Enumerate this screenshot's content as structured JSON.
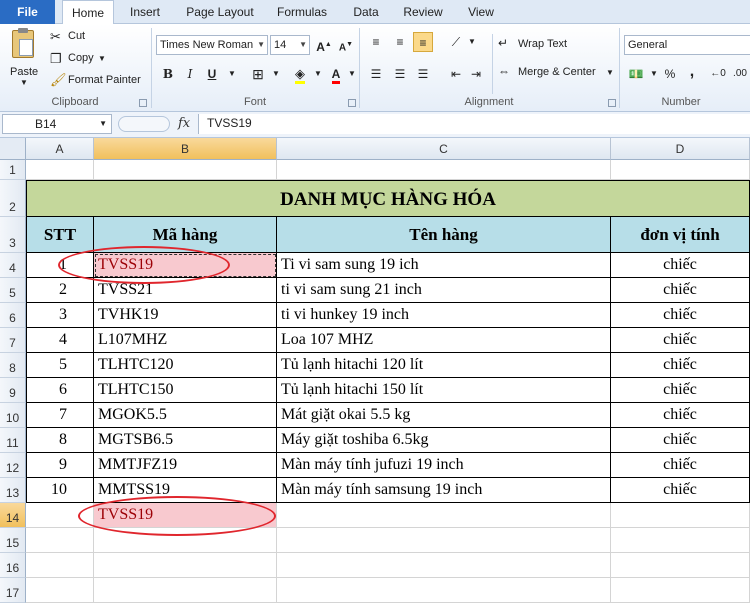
{
  "tabs": [
    "File",
    "Home",
    "Insert",
    "Page Layout",
    "Formulas",
    "Data",
    "Review",
    "View"
  ],
  "ribbon": {
    "clipboard": {
      "paste": "Paste",
      "cut": "Cut",
      "copy": "Copy",
      "format_painter": "Format Painter",
      "label": "Clipboard"
    },
    "font": {
      "name": "Times New Roman",
      "size": "14",
      "bold": "B",
      "italic": "I",
      "underline": "U",
      "label": "Font"
    },
    "alignment": {
      "wrap": "Wrap Text",
      "merge": "Merge & Center",
      "label": "Alignment"
    },
    "number": {
      "format": "General",
      "percent": "%",
      "comma": ",",
      "label": "Number"
    }
  },
  "formula_bar": {
    "name_box": "B14",
    "fx": "fx",
    "value": "TVSS19"
  },
  "columns": [
    "A",
    "B",
    "C",
    "D"
  ],
  "rows": [
    "1",
    "2",
    "3",
    "4",
    "5",
    "6",
    "7",
    "8",
    "9",
    "10",
    "11",
    "12",
    "13",
    "14",
    "15",
    "16",
    "17"
  ],
  "sheet": {
    "title": "DANH MỤC HÀNG HÓA",
    "headers": [
      "STT",
      "Mã hàng",
      "Tên hàng",
      "đơn vị tính"
    ],
    "data": [
      [
        "1",
        "TVSS19",
        "Ti vi sam sung 19 ich",
        "chiếc"
      ],
      [
        "2",
        "TVSS21",
        "ti vi sam sung 21 inch",
        "chiếc"
      ],
      [
        "3",
        "TVHK19",
        "ti vi hunkey 19 inch",
        "chiếc"
      ],
      [
        "4",
        "L107MHZ",
        "Loa 107 MHZ",
        "chiếc"
      ],
      [
        "5",
        "TLHTC120",
        "Tủ lạnh hitachi 120 lít",
        "chiếc"
      ],
      [
        "6",
        "TLHTC150",
        "Tủ lạnh hitachi 150 lít",
        "chiếc"
      ],
      [
        "7",
        "MGOK5.5",
        "Mát giặt okai 5.5 kg",
        "chiếc"
      ],
      [
        "8",
        "MGTSB6.5",
        "Máy giặt toshiba 6.5kg",
        "chiếc"
      ],
      [
        "9",
        "MMTJFZ19",
        "Màn máy tính jufuzi 19 inch",
        "chiếc"
      ],
      [
        "10",
        "MMTSS19",
        "Màn máy tính samsung 19 inch",
        "chiếc"
      ]
    ],
    "b14": "TVSS19"
  },
  "colors": {
    "title_fill": "#c4d79b",
    "header_fill": "#b7dee8",
    "highlight_fill": "#f8c9cf",
    "highlight_text": "#9c0006",
    "annotation": "#e0262d"
  }
}
